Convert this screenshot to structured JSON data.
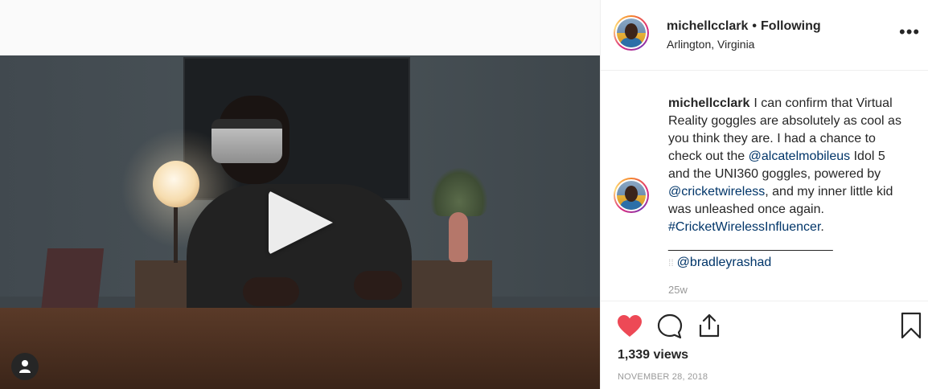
{
  "post": {
    "username": "michellcclark",
    "follow_status": "Following",
    "location": "Arlington, Virginia",
    "more_label": "•••",
    "caption": {
      "part1": "I can confirm that Virtual Reality goggles are absolutely as cool as you think they are. I had a chance to check out the ",
      "mention1": "@alcatelmobileus",
      "part2": " Idol 5 and the UNI360 goggles, powered by ",
      "mention2": "@cricketwireless",
      "part3": ", and my inner little kid was unleashed once again. ",
      "hashtag": "#CricketWirelessInfluencer",
      "part4": ".",
      "separator": "_______________________",
      "credit_prefix": "⁞⁞",
      "credit_mention": "@bradleyrashad"
    },
    "time_ago": "25w",
    "views": "1,339 views",
    "date": "NOVEMBER 28, 2018"
  },
  "icons": {
    "heart": "heart-icon",
    "comment": "comment-icon",
    "share": "share-icon",
    "save": "bookmark-icon",
    "play": "play-icon",
    "tag": "user-tag-icon"
  },
  "colors": {
    "heart": "#ed4956",
    "link": "#003569",
    "muted": "#999999"
  }
}
